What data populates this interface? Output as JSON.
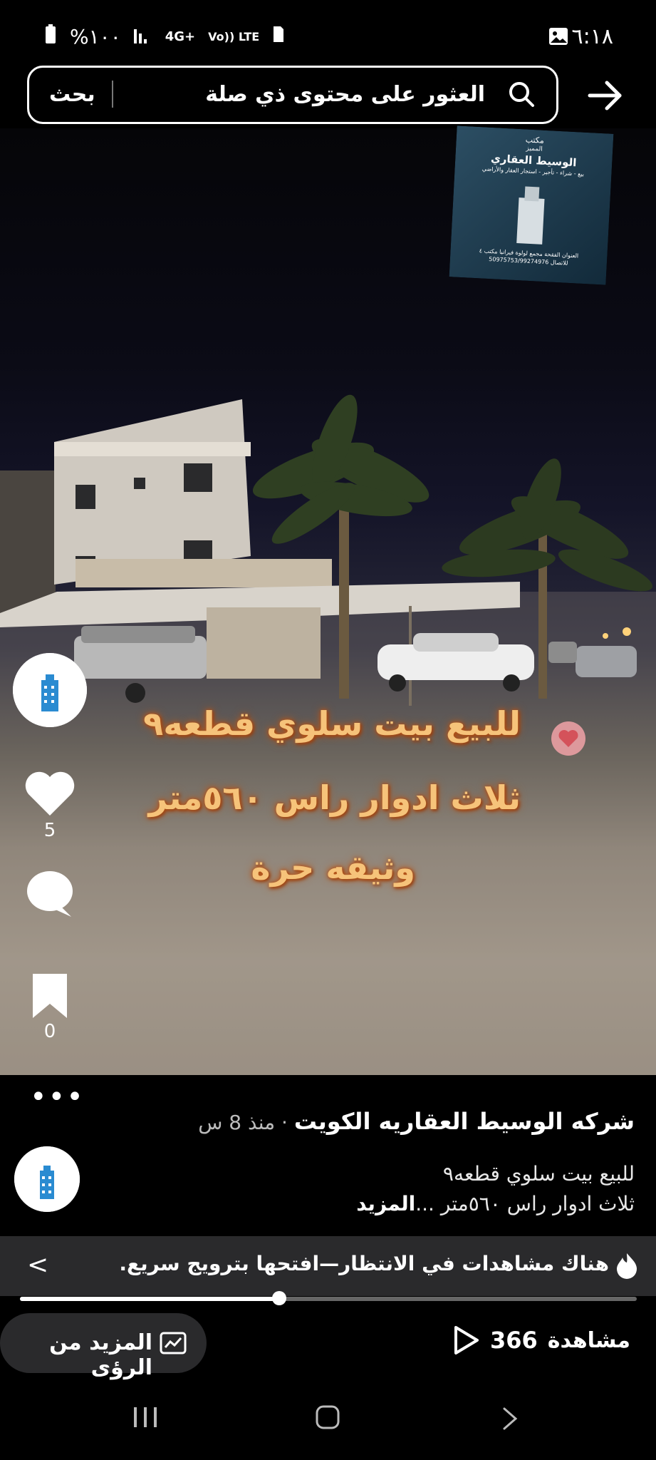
{
  "status_bar": {
    "time": "٦:١٨",
    "battery": "%١٠٠",
    "network": "4G+",
    "volte": "Vo)) LTE"
  },
  "search": {
    "placeholder": "العثور على محتوى ذي صلة",
    "button_label": "بحث"
  },
  "poster": {
    "line1": "مكتب",
    "line2": "المميز",
    "line3": "الوسيط العقاري",
    "line4": "بيع - شراء - تأجير - استجار العقار والأراضي",
    "line5": "العنوان الفقحة مجمع لولوة فيرانيا مكتب ٤",
    "line6": "للاتصال 50975753/99274976"
  },
  "overlay": {
    "line1": "للبيع بيت سلوي قطعه٩",
    "line2": "ثلاث ادوار راس ٥٦٠متر",
    "line3": "وثيقه حرة"
  },
  "actions": {
    "like_count": "5",
    "save_count": "0"
  },
  "post": {
    "more_dots": "•••",
    "author": "شركه الوسيط العقاريه الكويت",
    "separator": " · ",
    "time": "منذ 8 س",
    "caption_line1": "للبيع بيت سلوي قطعه٩",
    "caption_line2": "ثلاث ادوار راس ٥٦٠متر ...",
    "caption_more": "المزيد"
  },
  "promo": {
    "text": "هناك مشاهدات في الانتظار—افتحها بترويج سريع.",
    "chevron": "<"
  },
  "progress": {
    "fraction": 0.42
  },
  "insights": {
    "label": "المزيد من الرؤى"
  },
  "views": {
    "count": "366",
    "label": "مشاهدة"
  },
  "colors": {
    "overlay_text": "#f6c37a",
    "overlay_glow": "#b8561a",
    "banner_bg": "#2a2a2c"
  }
}
